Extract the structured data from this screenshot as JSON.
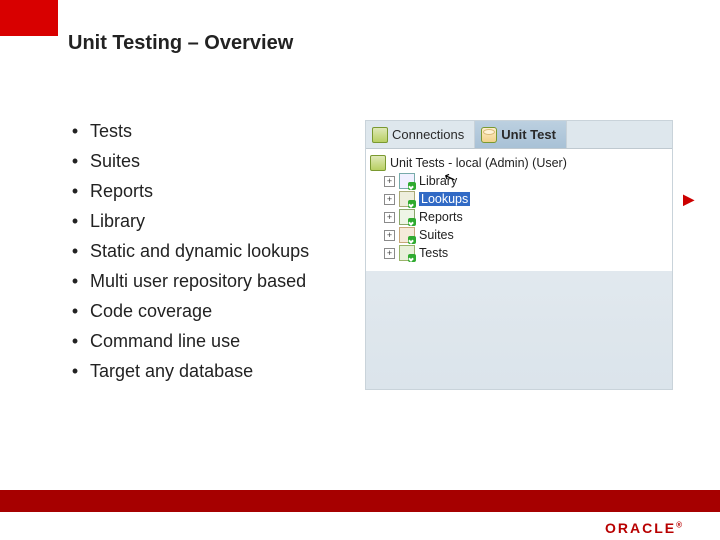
{
  "title": "Unit Testing – Overview",
  "bullets": [
    "Tests",
    "Suites",
    "Reports",
    "Library",
    "Static and dynamic lookups",
    "Multi user repository based",
    "Code coverage",
    "Command line use",
    "Target any database"
  ],
  "panel": {
    "tabs": {
      "connections": "Connections",
      "unit_test": "Unit Test"
    },
    "root": "Unit Tests - local (Admin) (User)",
    "nodes": {
      "library": "Library",
      "lookups": "Lookups",
      "reports": "Reports",
      "suites": "Suites",
      "tests": "Tests"
    }
  },
  "brand": {
    "name": "ORACLE",
    "mark": "®"
  },
  "glyphs": {
    "bullet": "•",
    "plus": "+",
    "arrow": "▶",
    "cursor": "↖"
  }
}
